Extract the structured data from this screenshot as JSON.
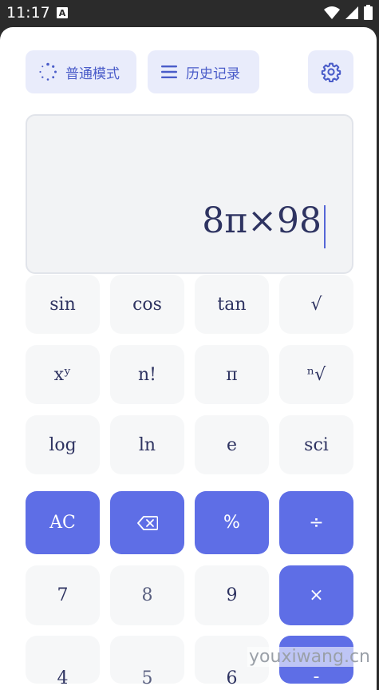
{
  "status": {
    "time": "11:17",
    "notif_letter": "A"
  },
  "toolbar": {
    "mode_label": "普通模式",
    "history_label": "历史记录"
  },
  "display": {
    "expression": "8π×98"
  },
  "keys": {
    "sin": "sin",
    "cos": "cos",
    "tan": "tan",
    "sqrt": "√",
    "pow": "xʸ",
    "fact": "n!",
    "pi": "π",
    "nroot": "ⁿ√",
    "log": "log",
    "ln": "ln",
    "e": "e",
    "sci": "sci",
    "ac": "AC",
    "pct": "%",
    "div": "÷",
    "k7": "7",
    "k8": "8",
    "k9": "9",
    "mul": "×",
    "k4": "4",
    "k5": "5",
    "k6": "6",
    "sub": "-"
  },
  "watermark": "youxiwang.cn",
  "colors": {
    "accent": "#5e6ee6",
    "accent_light": "#e9ecfb"
  }
}
